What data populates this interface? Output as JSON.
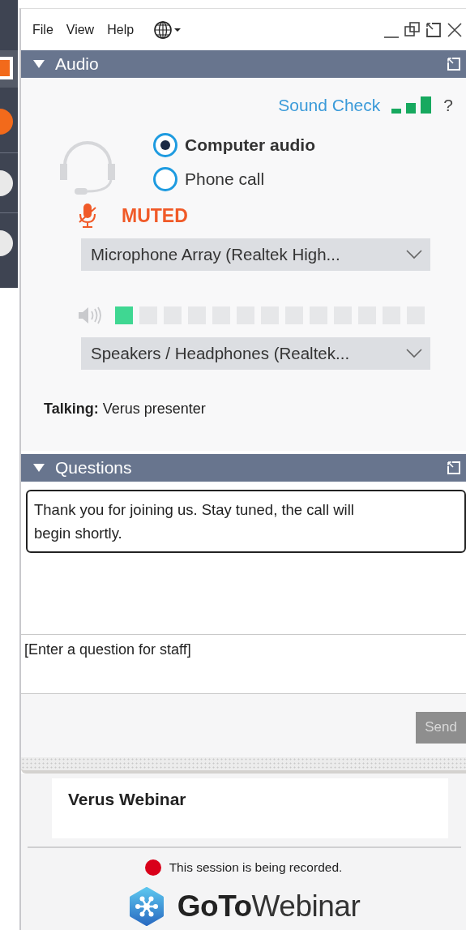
{
  "menu": [
    {
      "label": "File"
    },
    {
      "label": "View"
    },
    {
      "label": "Help"
    }
  ],
  "audio": {
    "title": "Audio",
    "expanded": true,
    "sound_check": "Sound Check",
    "help": "?",
    "modes": [
      {
        "label": "Computer audio",
        "selected": true
      },
      {
        "label": "Phone call",
        "selected": false
      }
    ],
    "mic_status": "MUTED",
    "muted": true,
    "microphone": "Microphone Array (Realtek High...",
    "level": 0.077,
    "speaker": "Speakers / Headphones (Realtek...",
    "talking": "**Talking:** Verus presenter"
  },
  "questions": {
    "title": "Questions",
    "expanded": true,
    "message": "Thank you for joining us. Stay tuned, the call will begin shortly.",
    "placeholder": "[Enter a question for staff]",
    "send": "Send",
    "send_disabled": true
  },
  "footer": {
    "webinar_title": "Verus Webinar",
    "recording": "This session is being recorded.",
    "logo": "**GoTo**Webinar"
  }
}
